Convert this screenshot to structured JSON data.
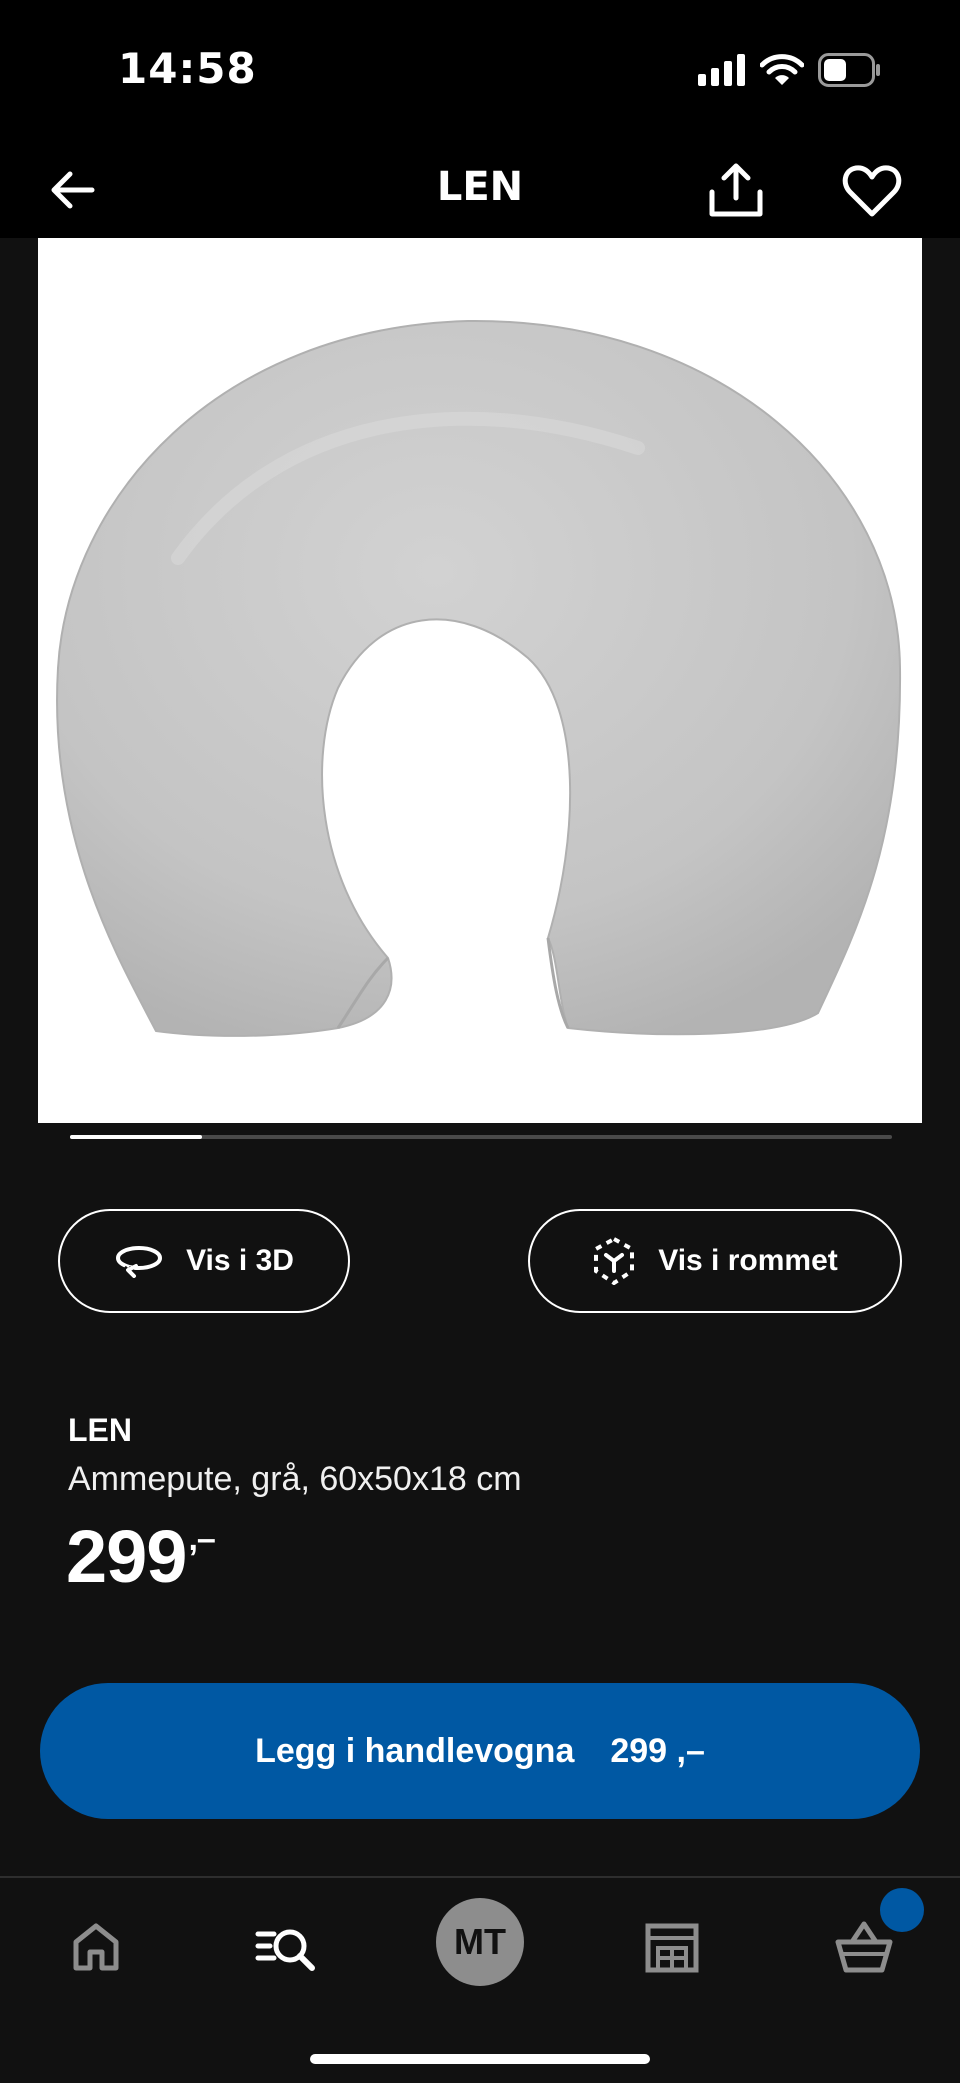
{
  "status_bar": {
    "time": "14:58",
    "icons": [
      "cellular-signal-icon",
      "wifi-icon",
      "battery-icon"
    ]
  },
  "header": {
    "title": "LEN",
    "icons": [
      "back-arrow-icon",
      "share-icon",
      "heart-icon"
    ]
  },
  "gallery": {
    "current_index": 1,
    "progress": 0.16
  },
  "actions": {
    "view_3d_label": "Vis i 3D",
    "view_room_label": "Vis i rommet"
  },
  "product": {
    "name": "LEN",
    "description": "Ammepute, grå, 60x50x18 cm",
    "price": "299",
    "price_suffix": ",–"
  },
  "cart_button": {
    "label": "Legg i handlevogna",
    "price": "299 ,–"
  },
  "tab_bar": {
    "avatar_initials": "MT",
    "items": [
      "home-icon",
      "search-icon",
      "avatar",
      "store-icon",
      "cart-icon"
    ],
    "cart_badge_color": "#0058a3"
  },
  "colors": {
    "accent": "#0058a3",
    "background": "#111111"
  }
}
